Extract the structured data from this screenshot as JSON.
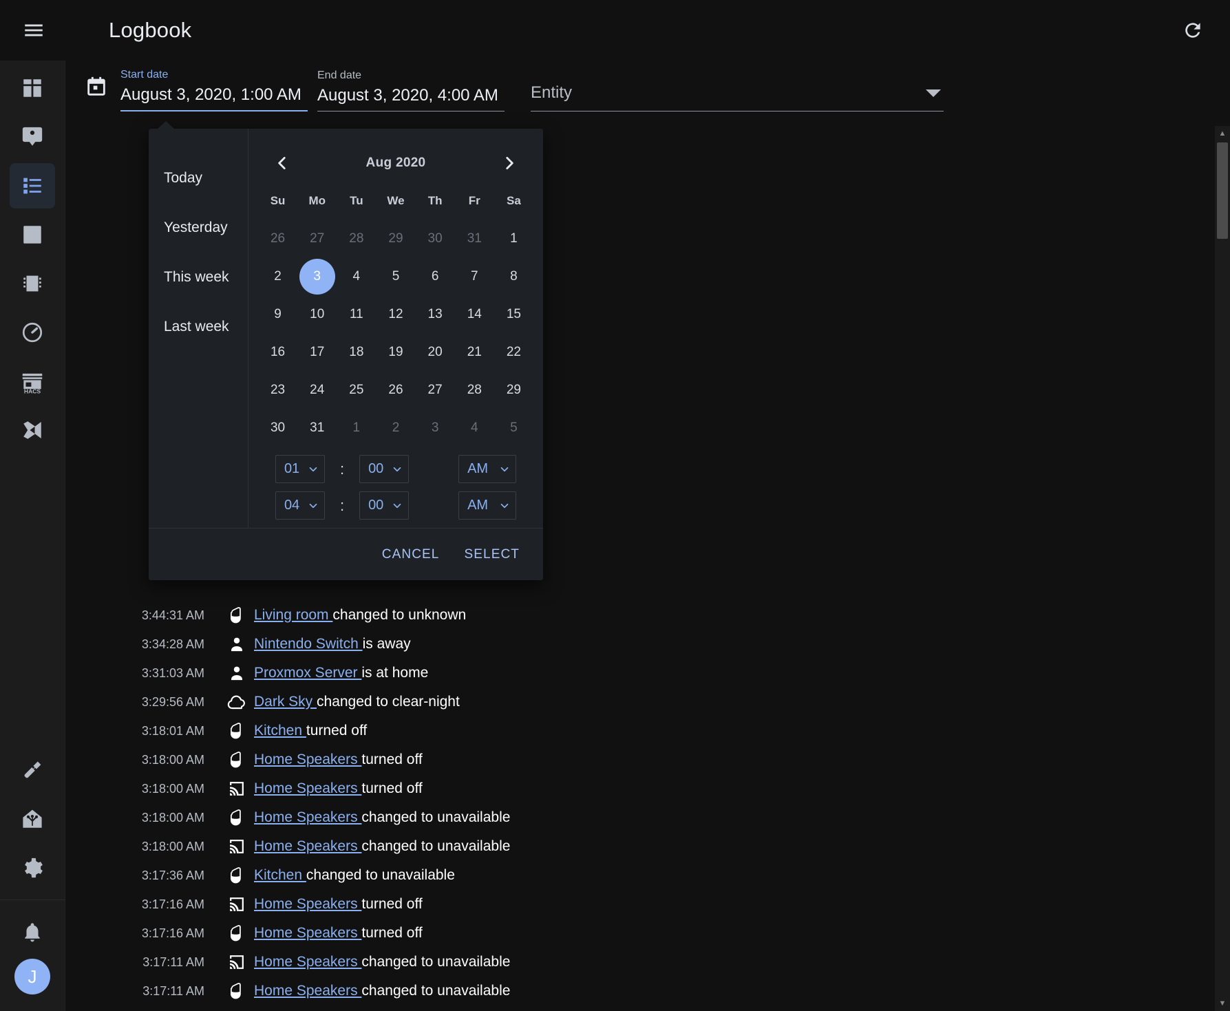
{
  "app": {
    "title": "Logbook",
    "menu_icon": "hamburger-menu-icon",
    "refresh_icon": "refresh-icon"
  },
  "sidebar": {
    "items": [
      {
        "name": "overview",
        "icon": "view-dashboard-icon",
        "active": false
      },
      {
        "name": "map",
        "icon": "map-marker-person-icon",
        "active": false
      },
      {
        "name": "logbook",
        "icon": "logbook-format-list-icon",
        "active": true
      },
      {
        "name": "history",
        "icon": "chart-box-icon",
        "active": false
      },
      {
        "name": "hardware",
        "icon": "chip-icon",
        "active": false
      },
      {
        "name": "gauge",
        "icon": "gauge-icon",
        "active": false
      },
      {
        "name": "hacs",
        "icon": "hacs-store-icon",
        "active": false
      },
      {
        "name": "vscode",
        "icon": "vscode-icon",
        "active": false
      }
    ],
    "bottom_items": [
      {
        "name": "developer-tools",
        "icon": "hammer-icon"
      },
      {
        "name": "supervisor",
        "icon": "home-assistant-logo-icon"
      },
      {
        "name": "configuration",
        "icon": "gear-icon"
      }
    ],
    "notifications": {
      "name": "notifications",
      "icon": "bell-icon"
    },
    "user": {
      "initial": "J",
      "name": "user-avatar"
    }
  },
  "filters": {
    "calendar_icon": "calendar-icon",
    "start": {
      "label": "Start date",
      "value": "August 3, 2020, 1:00 AM"
    },
    "end": {
      "label": "End date",
      "value": "August 3, 2020, 4:00 AM"
    },
    "entity": {
      "placeholder": "Entity",
      "value": "Entity"
    }
  },
  "picker": {
    "shortcuts": [
      "Today",
      "Yesterday",
      "This week",
      "Last week"
    ],
    "prev_icon": "chevron-left-icon",
    "next_icon": "chevron-right-icon",
    "month_label": "Aug 2020",
    "weekdays": [
      "Su",
      "Mo",
      "Tu",
      "We",
      "Th",
      "Fr",
      "Sa"
    ],
    "weeks": [
      [
        {
          "d": "26",
          "dim": true
        },
        {
          "d": "27",
          "dim": true
        },
        {
          "d": "28",
          "dim": true
        },
        {
          "d": "29",
          "dim": true
        },
        {
          "d": "30",
          "dim": true
        },
        {
          "d": "31",
          "dim": true
        },
        {
          "d": "1",
          "dim": false
        }
      ],
      [
        {
          "d": "2",
          "dim": false
        },
        {
          "d": "3",
          "dim": false,
          "selected": true
        },
        {
          "d": "4",
          "dim": false
        },
        {
          "d": "5",
          "dim": false
        },
        {
          "d": "6",
          "dim": false
        },
        {
          "d": "7",
          "dim": false
        },
        {
          "d": "8",
          "dim": false
        }
      ],
      [
        {
          "d": "9",
          "dim": false
        },
        {
          "d": "10",
          "dim": false
        },
        {
          "d": "11",
          "dim": false
        },
        {
          "d": "12",
          "dim": false
        },
        {
          "d": "13",
          "dim": false
        },
        {
          "d": "14",
          "dim": false
        },
        {
          "d": "15",
          "dim": false
        }
      ],
      [
        {
          "d": "16",
          "dim": false
        },
        {
          "d": "17",
          "dim": false
        },
        {
          "d": "18",
          "dim": false
        },
        {
          "d": "19",
          "dim": false
        },
        {
          "d": "20",
          "dim": false
        },
        {
          "d": "21",
          "dim": false
        },
        {
          "d": "22",
          "dim": false
        }
      ],
      [
        {
          "d": "23",
          "dim": false
        },
        {
          "d": "24",
          "dim": false
        },
        {
          "d": "25",
          "dim": false
        },
        {
          "d": "26",
          "dim": false
        },
        {
          "d": "27",
          "dim": false
        },
        {
          "d": "28",
          "dim": false
        },
        {
          "d": "29",
          "dim": false
        }
      ],
      [
        {
          "d": "30",
          "dim": false
        },
        {
          "d": "31",
          "dim": false
        },
        {
          "d": "1",
          "dim": true
        },
        {
          "d": "2",
          "dim": true
        },
        {
          "d": "3",
          "dim": true
        },
        {
          "d": "4",
          "dim": true
        },
        {
          "d": "5",
          "dim": true
        }
      ]
    ],
    "time_rows": [
      {
        "hour": "01",
        "minute": "00",
        "meridiem": "AM",
        "separator": ":"
      },
      {
        "hour": "04",
        "minute": "00",
        "meridiem": "AM",
        "separator": ":"
      }
    ],
    "cancel_label": "CANCEL",
    "select_label": "SELECT"
  },
  "logbook": {
    "entries": [
      {
        "time": "3:44:31 AM",
        "icon": "speaker-icon",
        "entity": "Living room ",
        "message": "changed to unknown"
      },
      {
        "time": "3:34:28 AM",
        "icon": "person-icon",
        "entity": "Nintendo Switch ",
        "message": "is away"
      },
      {
        "time": "3:31:03 AM",
        "icon": "person-icon",
        "entity": "Proxmox Server ",
        "message": "is at home"
      },
      {
        "time": "3:29:56 AM",
        "icon": "cloud-icon",
        "entity": "Dark Sky ",
        "message": "changed to clear-night"
      },
      {
        "time": "3:18:01 AM",
        "icon": "speaker-icon",
        "entity": "Kitchen ",
        "message": "turned off"
      },
      {
        "time": "3:18:00 AM",
        "icon": "speaker-icon",
        "entity": "Home Speakers ",
        "message": "turned off"
      },
      {
        "time": "3:18:00 AM",
        "icon": "cast-icon",
        "entity": "Home Speakers ",
        "message": "turned off"
      },
      {
        "time": "3:18:00 AM",
        "icon": "speaker-icon",
        "entity": "Home Speakers ",
        "message": "changed to unavailable"
      },
      {
        "time": "3:18:00 AM",
        "icon": "cast-icon",
        "entity": "Home Speakers ",
        "message": "changed to unavailable"
      },
      {
        "time": "3:17:36 AM",
        "icon": "speaker-icon",
        "entity": "Kitchen ",
        "message": "changed to unavailable"
      },
      {
        "time": "3:17:16 AM",
        "icon": "cast-icon",
        "entity": "Home Speakers ",
        "message": "turned off"
      },
      {
        "time": "3:17:16 AM",
        "icon": "speaker-icon",
        "entity": "Home Speakers ",
        "message": "turned off"
      },
      {
        "time": "3:17:11 AM",
        "icon": "cast-icon",
        "entity": "Home Speakers ",
        "message": "changed to unavailable"
      },
      {
        "time": "3:17:11 AM",
        "icon": "speaker-icon",
        "entity": "Home Speakers ",
        "message": "changed to unavailable"
      }
    ]
  },
  "colors": {
    "accent": "#8ab0f0",
    "background": "#111111",
    "sidebar": "#1c1c1c",
    "panel": "#1e2125",
    "text": "#ffffff"
  }
}
